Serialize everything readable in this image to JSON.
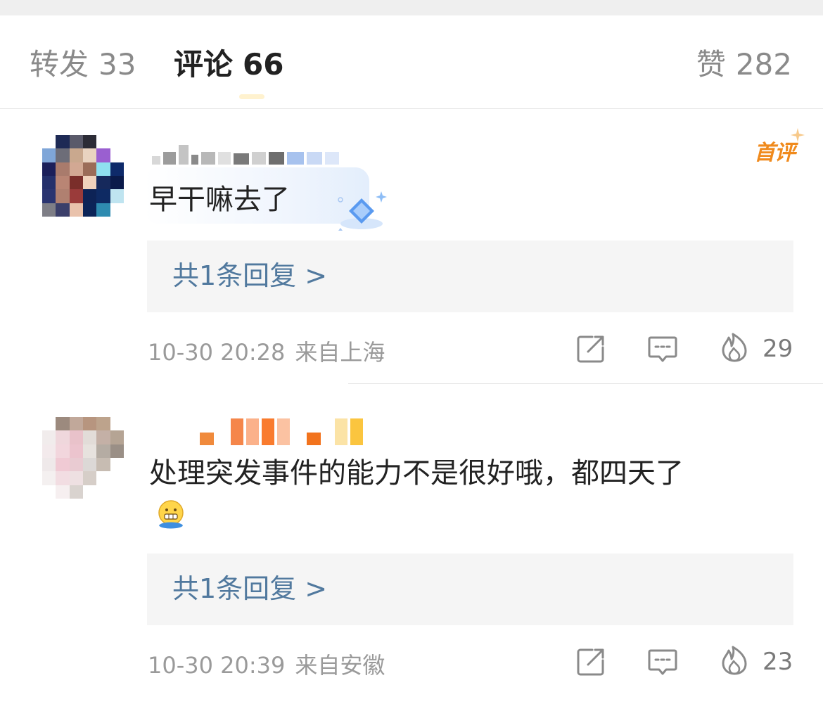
{
  "tabs": {
    "repost": {
      "label": "转发",
      "count": "33"
    },
    "comment": {
      "label": "评论",
      "count": "66"
    },
    "like": {
      "label": "赞",
      "count": "282"
    }
  },
  "comments": [
    {
      "text": "早干嘛去了",
      "first_badge": "首评",
      "reply_summary": "共1条回复 >",
      "time": "10-30 20:28",
      "location": "来自上海",
      "like_count": "29"
    },
    {
      "text": "处理突发事件的能力不是很好哦，都四天了",
      "emoji": "grimace-emoji",
      "reply_summary": "共1条回复 >",
      "time": "10-30 20:39",
      "location": "来自安徽",
      "like_count": "23"
    }
  ],
  "icons": {
    "repost": "share-edit-icon",
    "comment": "comment-bubble-icon",
    "like": "flame-icon"
  },
  "colors": {
    "link": "#51799e",
    "first_badge": "#f08a1c",
    "meta": "#9a9a9a"
  }
}
